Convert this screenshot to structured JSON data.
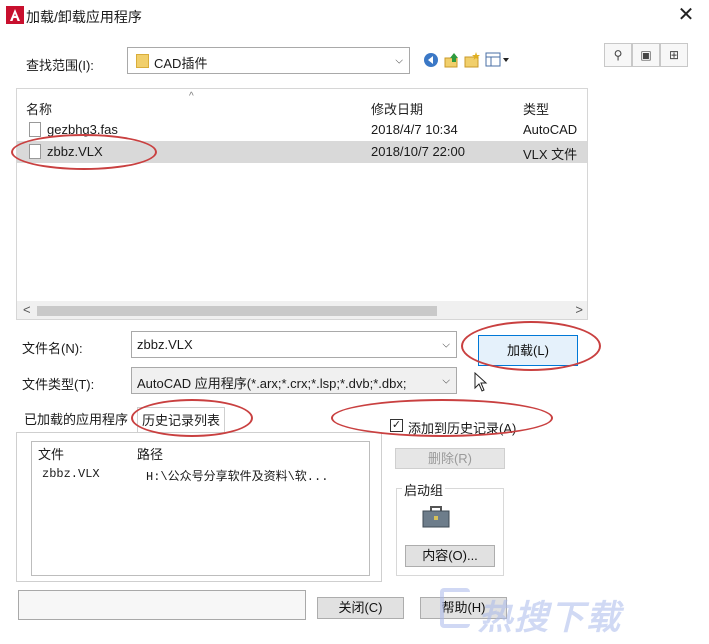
{
  "window": {
    "title": "加载/卸载应用程序",
    "close_glyph": "✕"
  },
  "lookin": {
    "label": "查找范围(I):",
    "value": "CAD插件"
  },
  "toolbar_icons": [
    "back-icon",
    "up-folder-icon",
    "new-folder-icon",
    "views-menu-icon"
  ],
  "right_icons": [
    "find-icon",
    "locations-icon",
    "options-icon"
  ],
  "file_list": {
    "columns": {
      "name": "名称",
      "modified": "修改日期",
      "type": "类型"
    },
    "rows": [
      {
        "name": "gezbhg3.fas",
        "modified": "2018/4/7 10:34",
        "type": "AutoCAD"
      },
      {
        "name": "zbbz.VLX",
        "modified": "2018/10/7 22:00",
        "type": "VLX 文件"
      }
    ]
  },
  "filename": {
    "label": "文件名(N):",
    "value": "zbbz.VLX"
  },
  "filetype": {
    "label": "文件类型(T):",
    "value": "AutoCAD 应用程序(*.arx;*.crx;*.lsp;*.dvb;*.dbx;"
  },
  "load_button": "加载(L)",
  "tabs": [
    {
      "label": "已加载的应用程序"
    },
    {
      "label": "历史记录列表"
    }
  ],
  "history": {
    "columns": {
      "file": "文件",
      "path": "路径"
    },
    "rows": [
      {
        "file": "zbbz.VLX",
        "path": "H:\\公众号分享软件及资料\\软..."
      }
    ]
  },
  "add_to_history": {
    "label": "添加到历史记录(A)",
    "checked": true
  },
  "remove_button": "删除(R)",
  "startup": {
    "title": "启动组",
    "contents_button": "内容(O)..."
  },
  "footer": {
    "close_button": "关闭(C)",
    "help_button": "帮助(H)"
  },
  "watermark": "热搜下载",
  "colors": {
    "annotation": "#c94040",
    "accent": "#0078d7"
  }
}
